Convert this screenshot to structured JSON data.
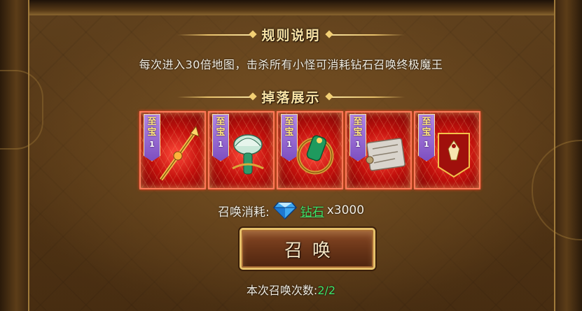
{
  "rules": {
    "title": "规则说明",
    "text": "每次进入30倍地图，击杀所有小怪可消耗钻石召唤终极魔王"
  },
  "drops": {
    "title": "掉落展示",
    "items": [
      {
        "badge": [
          "至",
          "宝"
        ],
        "tier": "1",
        "art": "golden-spear-icon"
      },
      {
        "badge": [
          "至",
          "宝"
        ],
        "tier": "1",
        "art": "jade-lotus-icon"
      },
      {
        "badge": [
          "至",
          "宝"
        ],
        "tier": "1",
        "art": "jade-ring-icon"
      },
      {
        "badge": [
          "至",
          "宝"
        ],
        "tier": "1",
        "art": "silver-scroll-icon"
      },
      {
        "badge": [
          "至",
          "宝"
        ],
        "tier": "1",
        "art": "red-banner-icon"
      }
    ]
  },
  "summon": {
    "cost_label": "召唤消耗:",
    "cost_icon": "diamond-icon",
    "cost_name": "钻石",
    "cost_amount": "x3000",
    "button_label": "召唤",
    "count_label": "本次召唤次数:",
    "count_value": "2/2"
  },
  "colors": {
    "title_gold": "#f8e3a6",
    "highlight_green": "#41e46a",
    "item_red": "#c3100c",
    "badge_purple": "#7d4fc0"
  }
}
